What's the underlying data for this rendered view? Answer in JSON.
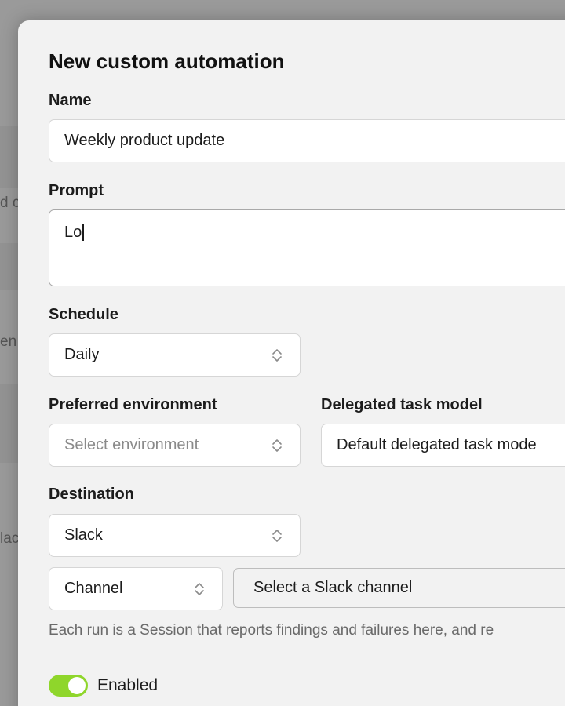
{
  "background": {
    "fragments": [
      "d c",
      "en",
      "lac"
    ]
  },
  "modal": {
    "title": "New custom automation",
    "name": {
      "label": "Name",
      "value": "Weekly product update"
    },
    "prompt": {
      "label": "Prompt",
      "value": "Lo"
    },
    "schedule": {
      "label": "Schedule",
      "value": "Daily"
    },
    "environment": {
      "label": "Preferred environment",
      "placeholder": "Select environment"
    },
    "model": {
      "label": "Delegated task model",
      "value": "Default delegated task mode"
    },
    "destination": {
      "label": "Destination",
      "value": "Slack"
    },
    "channel_type": {
      "value": "Channel"
    },
    "slack_channel": {
      "placeholder": "Select a Slack channel"
    },
    "helper_text": "Each run is a Session that reports findings and failures here, and re",
    "enabled": {
      "label": "Enabled",
      "on": true,
      "color": "#8fd62b"
    }
  }
}
